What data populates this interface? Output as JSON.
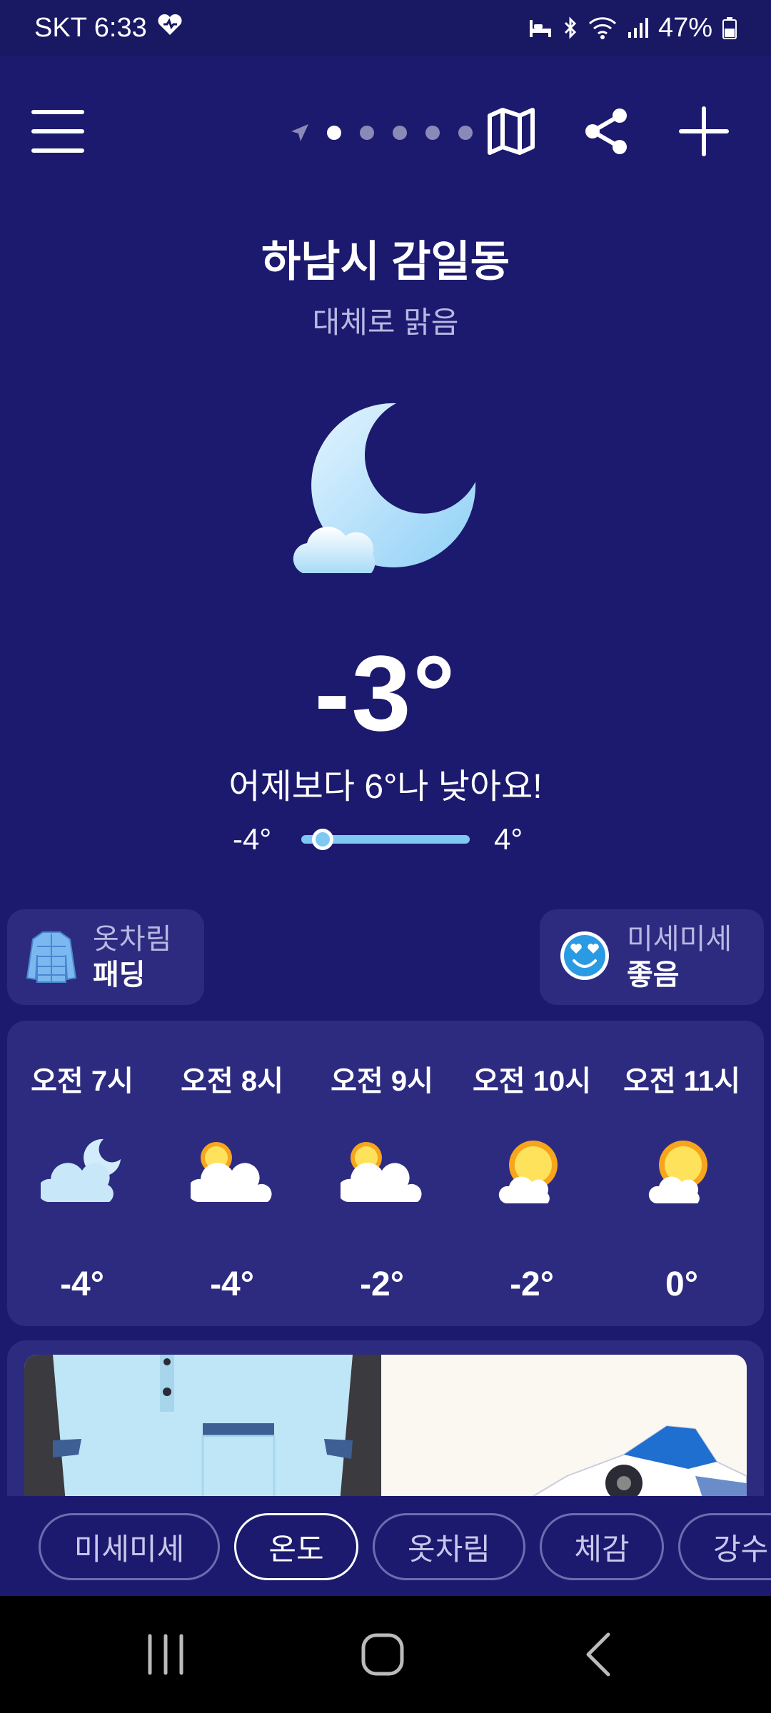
{
  "status_bar": {
    "carrier_time": "SKT 6:33",
    "battery": "47%",
    "icons": [
      "heart-icon",
      "sleep-icon",
      "bluetooth-icon",
      "wifi-icon",
      "signal-icon",
      "battery-icon"
    ]
  },
  "toolbar": {
    "icons": [
      "menu-icon",
      "location-arrow-icon",
      "map-icon",
      "share-icon",
      "add-icon"
    ],
    "page_count": 5,
    "active_page": 0
  },
  "weather": {
    "location": "하남시 감일동",
    "condition": "대체로 맑음",
    "temperature": "-3°",
    "comparison": "어제보다 6°나 낮아요!",
    "low": "-4°",
    "high": "4°",
    "current_position": 0.125,
    "main_icon": "moon-cloud-icon"
  },
  "chips": {
    "clothing_title": "옷차림",
    "clothing_value": "패딩",
    "dust_title": "미세미세",
    "dust_value": "좋음"
  },
  "hourly": [
    {
      "time": "오전 7시",
      "icon": "moon-cloud-icon",
      "temp": "-4°"
    },
    {
      "time": "오전 8시",
      "icon": "sun-cloud-icon",
      "temp": "-4°"
    },
    {
      "time": "오전 9시",
      "icon": "sun-cloud-icon",
      "temp": "-2°"
    },
    {
      "time": "오전 10시",
      "icon": "sun-small-cloud-icon",
      "temp": "-2°"
    },
    {
      "time": "오전 11시",
      "icon": "sun-small-cloud-icon",
      "temp": "0°"
    }
  ],
  "tabs": [
    "미세미세",
    "온도",
    "옷차림",
    "체감",
    "강수"
  ],
  "active_tab": 1,
  "colors": {
    "background": "#1c1a6e",
    "card": "#2d2b80",
    "accent": "#7fc8f2"
  }
}
